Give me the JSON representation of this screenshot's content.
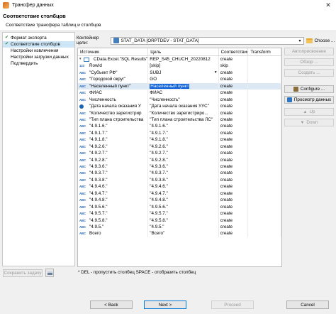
{
  "window": {
    "title": "Трансфер данных",
    "close_glyph": "✕"
  },
  "header": {
    "title": "Соответствие столбцов",
    "subtitle": "Соответствие трансфера таблиц и столбцов"
  },
  "nav": {
    "items": [
      {
        "label": "Формат экспорта",
        "checked": true,
        "selected": false
      },
      {
        "label": "Соответствие столбцов",
        "checked": true,
        "selected": true
      },
      {
        "label": "Настройки извлечения",
        "checked": false,
        "selected": false
      },
      {
        "label": "Настройки загрузки данных",
        "checked": false,
        "selected": false
      },
      {
        "label": "Подтвердить",
        "checked": false,
        "selected": false
      }
    ]
  },
  "container": {
    "label": "Контейнер цели:",
    "value": "STAT_DATA [ORPTDEV - STAT_DATA]",
    "choose_label": "Choose ..."
  },
  "grid": {
    "columns": [
      "Источник",
      "Цель",
      "Соответствие",
      "Transform"
    ],
    "rows": [
      {
        "indent": 0,
        "icon": "table",
        "expand": "▾",
        "source": "CData.Excel.\"SQL Results\"",
        "target": "REP_S45_CHUCH_20220812",
        "mapping": "create",
        "transform": ""
      },
      {
        "indent": 1,
        "icon": "123",
        "source": "RowId",
        "target": "[skip]",
        "mapping": "skip",
        "transform": ""
      },
      {
        "indent": 1,
        "icon": "ABC",
        "source": "\"Субъект РФ\"",
        "target": "SUBJ",
        "mapping": "create",
        "transform": "",
        "dropdown": true
      },
      {
        "indent": 1,
        "icon": "ABC",
        "source": "\"Городской округ\"",
        "target": "GO",
        "mapping": "create",
        "transform": ""
      },
      {
        "indent": 1,
        "icon": "ABC",
        "source": "\"Населенный пункт\"",
        "target": "Населенный пункт",
        "mapping": "create",
        "transform": "",
        "selected": true,
        "editing": true
      },
      {
        "indent": 1,
        "icon": "ABC",
        "source": "ФИАС",
        "target": "ФИАС",
        "mapping": "create",
        "transform": ""
      },
      {
        "indent": 1,
        "icon": "ABC",
        "source": "Численность",
        "target": "\"Численность\"",
        "mapping": "create",
        "transform": ""
      },
      {
        "indent": 1,
        "icon": "date",
        "source": "\"Дата начала оказания У",
        "target": "\"Дата начала оказания УУС\"",
        "mapping": "create",
        "transform": ""
      },
      {
        "indent": 1,
        "icon": "ABC",
        "source": "\"Количество зарегистрир",
        "target": "\"Количество зарегистриро...",
        "mapping": "create",
        "transform": ""
      },
      {
        "indent": 1,
        "icon": "ABC",
        "source": "\"Тип плана строительства",
        "target": "\"Тип плана строительства ЛС\"",
        "mapping": "create",
        "transform": ""
      },
      {
        "indent": 1,
        "icon": "ABC",
        "source": "\"4.9.1.6.\"",
        "target": "\"4.9.1.6.\"",
        "mapping": "create",
        "transform": ""
      },
      {
        "indent": 1,
        "icon": "ABC",
        "source": "\"4.9.1.7.\"",
        "target": "\"4.9.1.7.\"",
        "mapping": "create",
        "transform": ""
      },
      {
        "indent": 1,
        "icon": "ABC",
        "source": "\"4.9.1.8.\"",
        "target": "\"4.9.1.8.\"",
        "mapping": "create",
        "transform": ""
      },
      {
        "indent": 1,
        "icon": "ABC",
        "source": "\"4.9.2.6.\"",
        "target": "\"4.9.2.6.\"",
        "mapping": "create",
        "transform": ""
      },
      {
        "indent": 1,
        "icon": "ABC",
        "source": "\"4.9.2.7.\"",
        "target": "\"4.9.2.7.\"",
        "mapping": "create",
        "transform": ""
      },
      {
        "indent": 1,
        "icon": "ABC",
        "source": "\"4.9.2.8.\"",
        "target": "\"4.9.2.8.\"",
        "mapping": "create",
        "transform": ""
      },
      {
        "indent": 1,
        "icon": "ABC",
        "source": "\"4.9.3.6.\"",
        "target": "\"4.9.3.6.\"",
        "mapping": "create",
        "transform": ""
      },
      {
        "indent": 1,
        "icon": "ABC",
        "source": "\"4.9.3.7.\"",
        "target": "\"4.9.3.7.\"",
        "mapping": "create",
        "transform": ""
      },
      {
        "indent": 1,
        "icon": "ABC",
        "source": "\"4.9.3.8.\"",
        "target": "\"4.9.3.8.\"",
        "mapping": "create",
        "transform": ""
      },
      {
        "indent": 1,
        "icon": "ABC",
        "source": "\"4.9.4.6.\"",
        "target": "\"4.9.4.6.\"",
        "mapping": "create",
        "transform": ""
      },
      {
        "indent": 1,
        "icon": "ABC",
        "source": "\"4.9.4.7.\"",
        "target": "\"4.9.4.7.\"",
        "mapping": "create",
        "transform": ""
      },
      {
        "indent": 1,
        "icon": "ABC",
        "source": "\"4.9.4.8.\"",
        "target": "\"4.9.4.8.\"",
        "mapping": "create",
        "transform": ""
      },
      {
        "indent": 1,
        "icon": "ABC",
        "source": "\"4.9.5.6.\"",
        "target": "\"4.9.5.6.\"",
        "mapping": "create",
        "transform": ""
      },
      {
        "indent": 1,
        "icon": "ABC",
        "source": "\"4.9.5.7.\"",
        "target": "\"4.9.5.7.\"",
        "mapping": "create",
        "transform": ""
      },
      {
        "indent": 1,
        "icon": "ABC",
        "source": "\"4.9.5.8.\"",
        "target": "\"4.9.5.8.\"",
        "mapping": "create",
        "transform": ""
      },
      {
        "indent": 1,
        "icon": "ABC",
        "source": "\"4.9.5.\"",
        "target": "\"4.9.5.\"",
        "mapping": "create",
        "transform": ""
      },
      {
        "indent": 1,
        "icon": "ABC",
        "source": "Всего",
        "target": "\"Всего\"",
        "mapping": "create",
        "transform": ""
      }
    ]
  },
  "side_buttons": [
    {
      "label": "Автоприсвоение",
      "enabled": false,
      "icon": ""
    },
    {
      "label": "Обзор ...",
      "enabled": false,
      "icon": ""
    },
    {
      "label": "Создать ...",
      "enabled": false,
      "icon": ""
    },
    {
      "label": "Configure ...",
      "enabled": true,
      "icon": "cfg"
    },
    {
      "label": "Просмотр данных",
      "enabled": true,
      "icon": "prev"
    },
    {
      "label": "Up",
      "enabled": false,
      "icon": "▲"
    },
    {
      "label": "Down",
      "enabled": false,
      "icon": "▼"
    }
  ],
  "hint": "* DEL - пропустить столбец  SPACE - отобразить столбец",
  "bottom_left": {
    "save_label": "Сохранить задачу"
  },
  "footer": {
    "back_label": "< Back",
    "next_label": "Next >",
    "proceed_label": "Proceed",
    "cancel_label": "Cancel"
  },
  "colors": {
    "selection": "#0b5fd8",
    "row_selected": "#dde8f5",
    "nav_selected": "#cde6f7"
  }
}
